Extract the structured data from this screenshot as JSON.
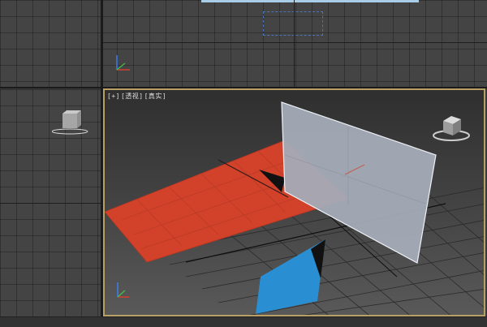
{
  "viewports": {
    "top_left": {
      "name": "orthographic-top-left"
    },
    "top_right": {
      "name": "orthographic-top"
    },
    "left": {
      "name": "orthographic-left"
    },
    "perspective": {
      "label_plus": "[+]",
      "label_view": "[透视]",
      "label_shading": "[真实]"
    }
  },
  "colors": {
    "red_plane": "#d2412a",
    "glass_plane": "#a4abb7",
    "blue_plane": "#2a8fd2",
    "active_border": "#b8a065"
  }
}
